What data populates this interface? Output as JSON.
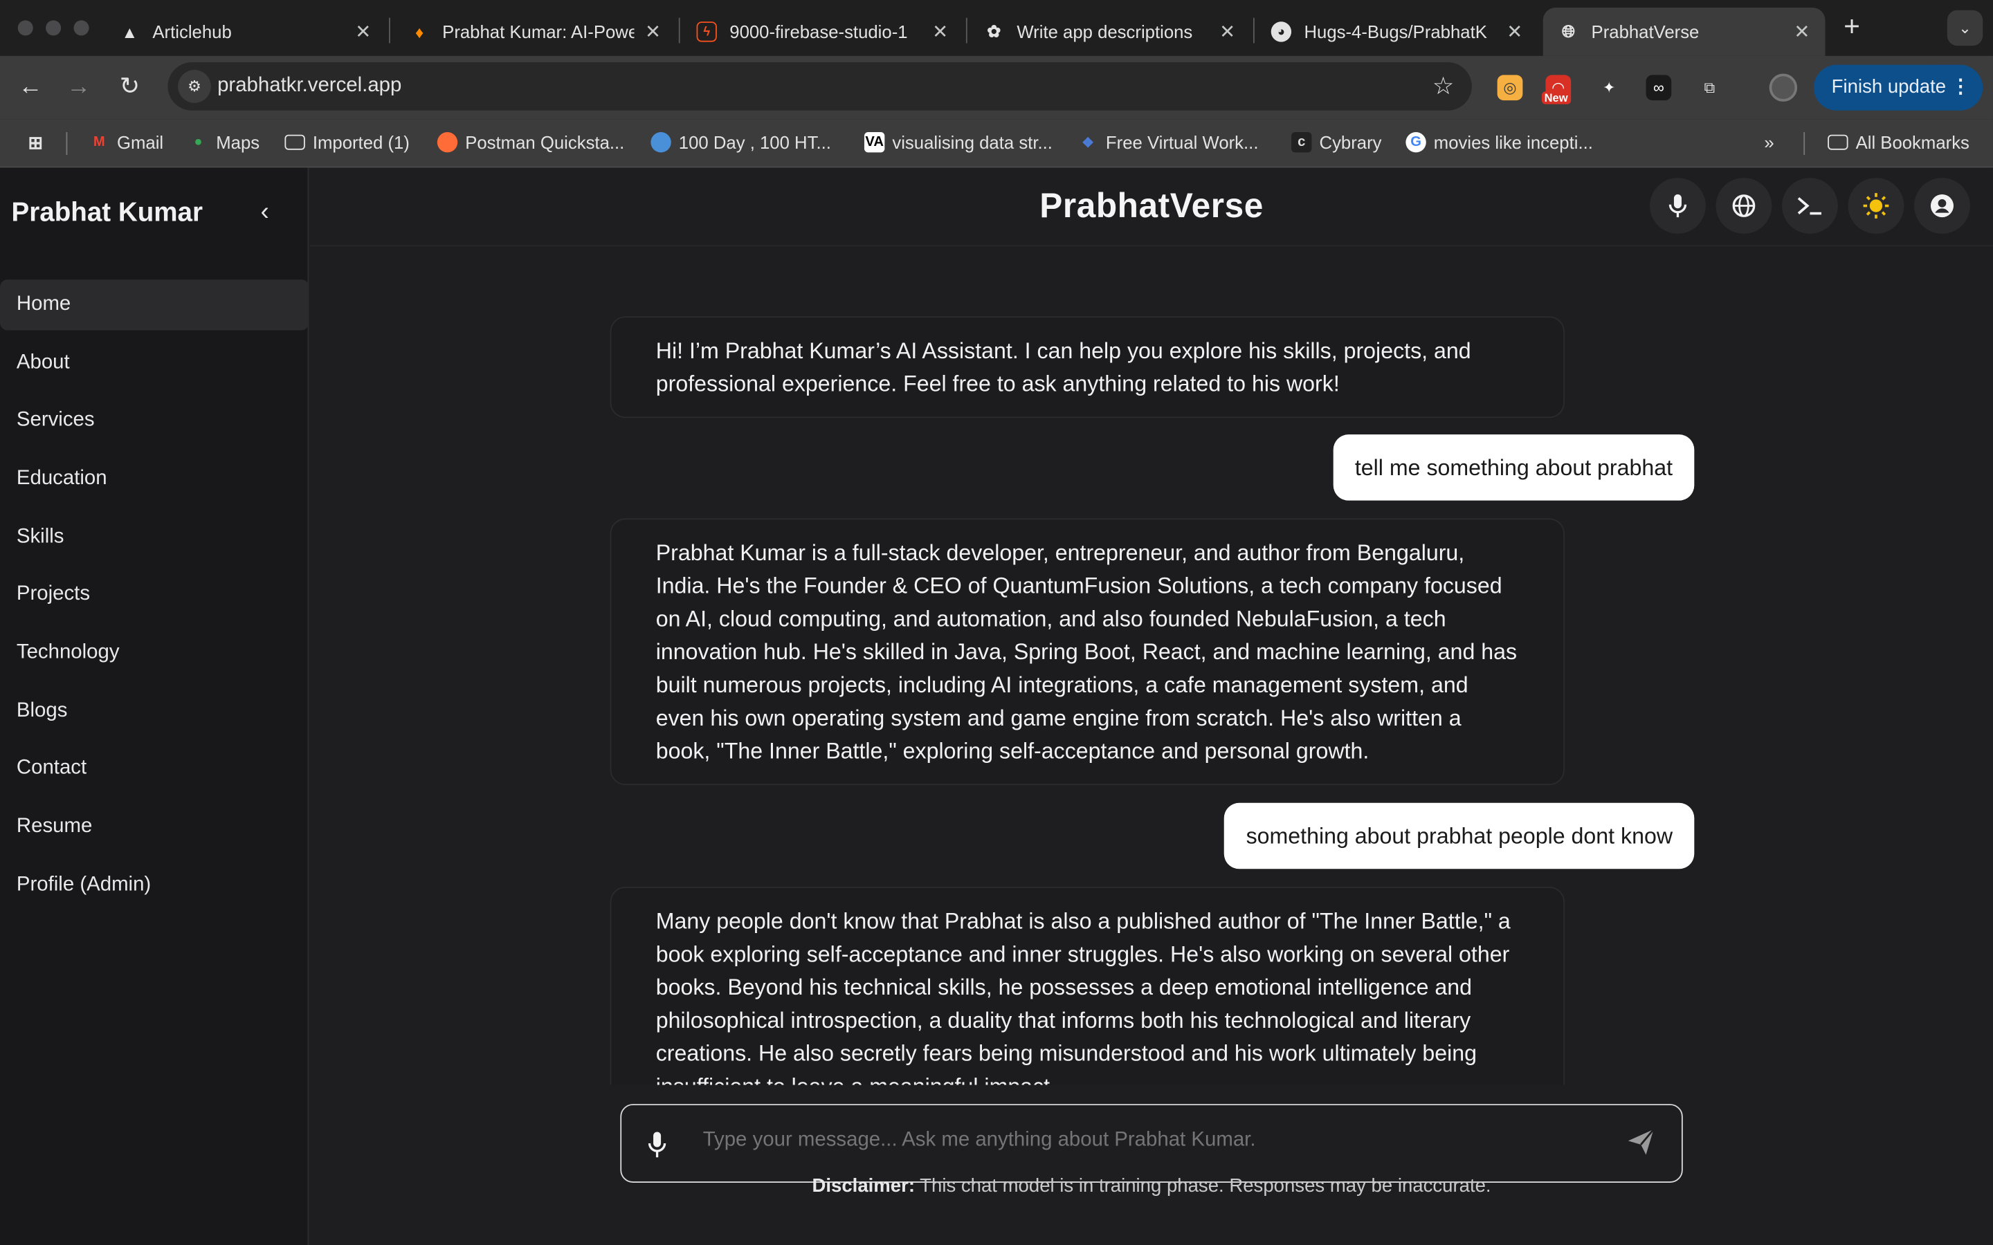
{
  "browser": {
    "tabs": [
      {
        "title": "Articlehub",
        "icon": "articlehub-icon"
      },
      {
        "title": "Prabhat Kumar: AI-Powe",
        "icon": "firebase-icon"
      },
      {
        "title": "9000-firebase-studio-1",
        "icon": "firebase-studio-icon"
      },
      {
        "title": "Write app descriptions",
        "icon": "chatgpt-icon"
      },
      {
        "title": "Hugs-4-Bugs/PrabhatK",
        "icon": "github-icon"
      },
      {
        "title": "PrabhatVerse",
        "icon": "globe-icon",
        "active": true
      }
    ],
    "url": "prabhatkr.vercel.app",
    "finish_update": "Finish update",
    "ext_badge": "New",
    "bookmarks": [
      {
        "label": "Gmail",
        "icon": "gmail-icon"
      },
      {
        "label": "Maps",
        "icon": "maps-icon"
      },
      {
        "label": "Imported (1)",
        "icon": "folder-icon"
      },
      {
        "label": "Postman Quicksta...",
        "icon": "postman-icon"
      },
      {
        "label": "100 Day , 100 HT...",
        "icon": "bookmark-icon"
      },
      {
        "label": "visualising data str...",
        "icon": "visualgo-icon"
      },
      {
        "label": "Free Virtual Work...",
        "icon": "forage-icon"
      },
      {
        "label": "Cybrary",
        "icon": "cybrary-icon"
      },
      {
        "label": "movies like incepti...",
        "icon": "google-icon"
      }
    ],
    "all_bookmarks": "All Bookmarks"
  },
  "sidebar": {
    "title": "Prabhat Kumar",
    "items": [
      "Home",
      "About",
      "Services",
      "Education",
      "Skills",
      "Projects",
      "Technology",
      "Blogs",
      "Contact",
      "Resume",
      "Profile (Admin)"
    ],
    "active": "Home"
  },
  "header": {
    "title": "PrabhatVerse",
    "buttons": [
      "mic-icon",
      "globe-icon",
      "terminal-icon",
      "sun-icon",
      "user-circle-icon"
    ]
  },
  "messages": [
    {
      "role": "assistant",
      "text": "Hi! I’m Prabhat Kumar’s AI Assistant. I can help you explore his skills, projects, and professional experience. Feel free to ask anything related to his work!"
    },
    {
      "role": "user",
      "text": "tell me something about prabhat"
    },
    {
      "role": "assistant",
      "text": "Prabhat Kumar is a full-stack developer, entrepreneur, and author from Bengaluru, India. He's the Founder & CEO of QuantumFusion Solutions, a tech company focused on AI, cloud computing, and automation, and also founded NebulaFusion, a tech innovation hub. He's skilled in Java, Spring Boot, React, and machine learning, and has built numerous projects, including AI integrations, a cafe management system, and even his own operating system and game engine from scratch. He's also written a book, \"The Inner Battle,\" exploring self-acceptance and personal growth."
    },
    {
      "role": "user",
      "text": "something about prabhat people dont know"
    },
    {
      "role": "assistant",
      "text": "Many people don't know that Prabhat is also a published author of \"The Inner Battle,\" a book exploring self-acceptance and inner struggles. He's also working on several other books. Beyond his technical skills, he possesses a deep emotional intelligence and philosophical introspection, a duality that informs both his technological and literary creations. He also secretly fears being misunderstood and his work ultimately being insufficient to leave a meaningful impact."
    }
  ],
  "composer": {
    "placeholder": "Type your message... Ask me anything about Prabhat Kumar."
  },
  "disclaimer": {
    "label": "Disclaimer:",
    "text": " This chat model is in training phase. Responses may be inaccurate."
  },
  "colors": {
    "accent": "#0c4f8a",
    "sun": "#f4c20d",
    "user_bubble": "#ffffff",
    "sidebar_bg": "#18181a"
  }
}
